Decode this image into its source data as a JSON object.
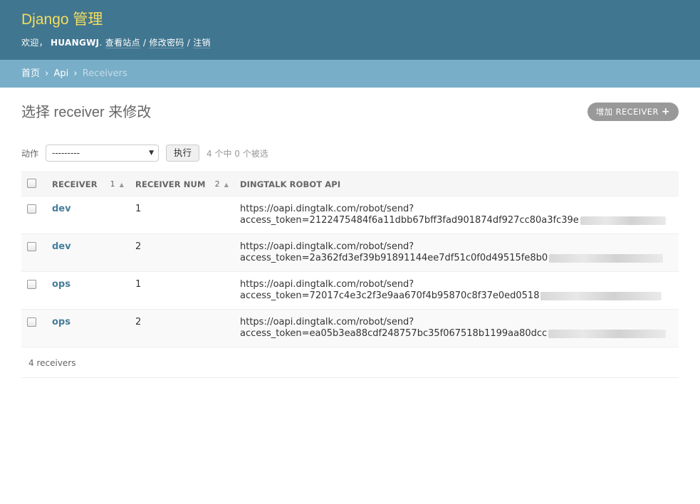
{
  "header": {
    "branding": "Django 管理",
    "welcome": "欢迎，",
    "username": "HUANGWJ",
    "period": ".",
    "view_site": "查看站点",
    "sep": " / ",
    "change_password": "修改密码",
    "logout": "注销"
  },
  "breadcrumbs": {
    "home": "首页",
    "app": "Api",
    "current": "Receivers",
    "separator": "›"
  },
  "content": {
    "title": "选择 receiver 来修改",
    "add_button": "增加 RECEIVER",
    "add_icon": "+"
  },
  "actions": {
    "label": "动作",
    "select_value": "---------",
    "go": "执行",
    "counter": "4 个中 0 个被选"
  },
  "table": {
    "headers": {
      "receiver": "RECEIVER",
      "receiver_sort": "1",
      "receiver_num": "RECEIVER NUM",
      "receiver_num_sort": "2",
      "api": "DINGTALK ROBOT API"
    },
    "rows": [
      {
        "receiver": "dev",
        "num": "1",
        "api_line1": "https://oapi.dingtalk.com/robot/send?",
        "api_line2": "access_token=2122475484f6a11dbb67bff3fad901874df927cc80a3fc39e"
      },
      {
        "receiver": "dev",
        "num": "2",
        "api_line1": "https://oapi.dingtalk.com/robot/send?",
        "api_line2": "access_token=2a362fd3ef39b91891144ee7df51c0f0d49515fe8b0"
      },
      {
        "receiver": "ops",
        "num": "1",
        "api_line1": "https://oapi.dingtalk.com/robot/send?",
        "api_line2": "access_token=72017c4e3c2f3e9aa670f4b95870c8f37e0ed0518"
      },
      {
        "receiver": "ops",
        "num": "2",
        "api_line1": "https://oapi.dingtalk.com/robot/send?",
        "api_line2": "access_token=ea05b3ea88cdf248757bc35f067518b1199aa80dcc"
      }
    ]
  },
  "paginator": "4 receivers",
  "colors": {
    "header_bg": "#417690",
    "branding": "#f5dd5d",
    "breadcrumbs_bg": "#79aec8",
    "link": "#447e9b"
  }
}
